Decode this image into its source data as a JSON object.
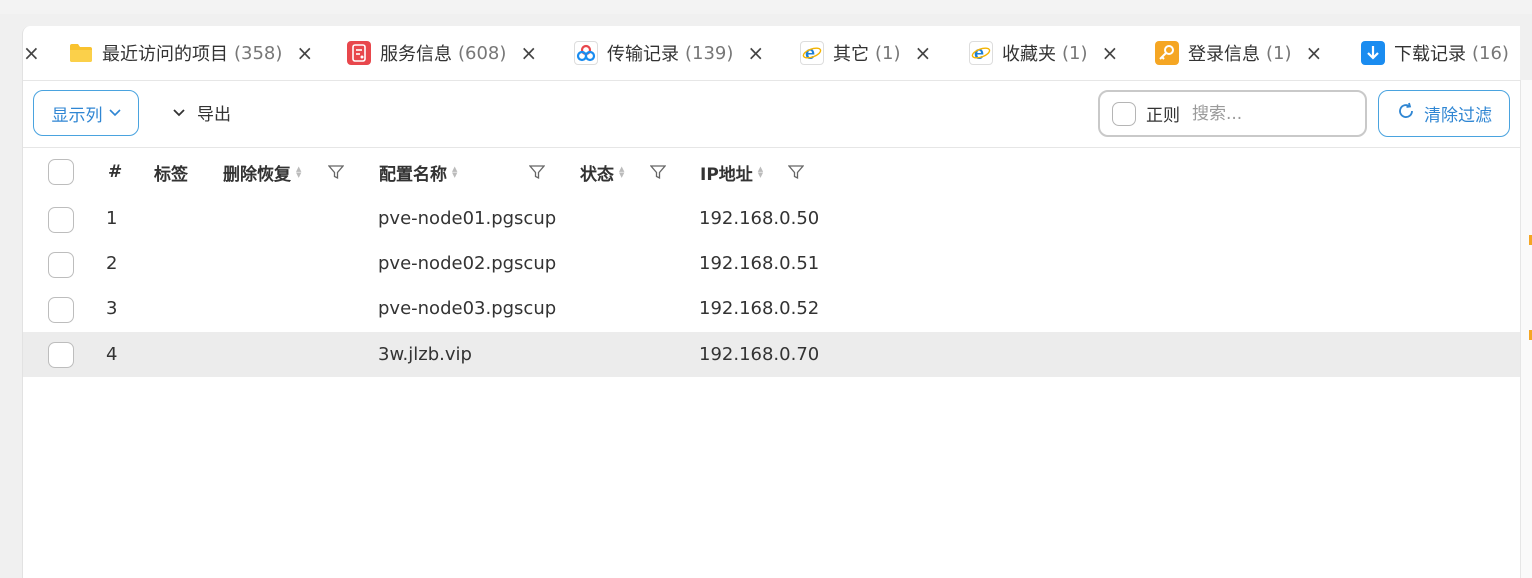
{
  "tabs": [
    {
      "label": "最近访问的项目",
      "count": "(358)",
      "icon": "folder-icon"
    },
    {
      "label": "服务信息",
      "count": "(608)",
      "icon": "service-doc-icon"
    },
    {
      "label": "传输记录",
      "count": "(139)",
      "icon": "transfer-icon"
    },
    {
      "label": "其它",
      "count": "(1)",
      "icon": "ie-browser-icon"
    },
    {
      "label": "收藏夹",
      "count": "(1)",
      "icon": "ie-browser-icon"
    },
    {
      "label": "登录信息",
      "count": "(1)",
      "icon": "key-icon"
    },
    {
      "label": "下载记录",
      "count": "(16)",
      "icon": "download-icon"
    }
  ],
  "toolbar": {
    "columns_label": "显示列",
    "export_label": "导出",
    "regex_label": "正则",
    "search_placeholder": "搜索...",
    "clear_filter_label": "清除过滤"
  },
  "table": {
    "headers": {
      "index": "#",
      "tag": "标签",
      "delete_restore": "删除恢复",
      "config_name": "配置名称",
      "status": "状态",
      "ip": "IP地址"
    },
    "rows": [
      {
        "index": "1",
        "name": "pve-node01.pgscup",
        "ip": "192.168.0.50"
      },
      {
        "index": "2",
        "name": "pve-node02.pgscup",
        "ip": "192.168.0.51"
      },
      {
        "index": "3",
        "name": "pve-node03.pgscup",
        "ip": "192.168.0.52"
      },
      {
        "index": "4",
        "name": "3w.jlzb.vip",
        "ip": "192.168.0.70"
      }
    ]
  },
  "colors": {
    "accent": "#2f86d3",
    "folder": "#f9c22e",
    "service": "#e8474c",
    "key": "#f5a623",
    "download": "#1a8cf0",
    "ie": "#1e7fd6"
  }
}
